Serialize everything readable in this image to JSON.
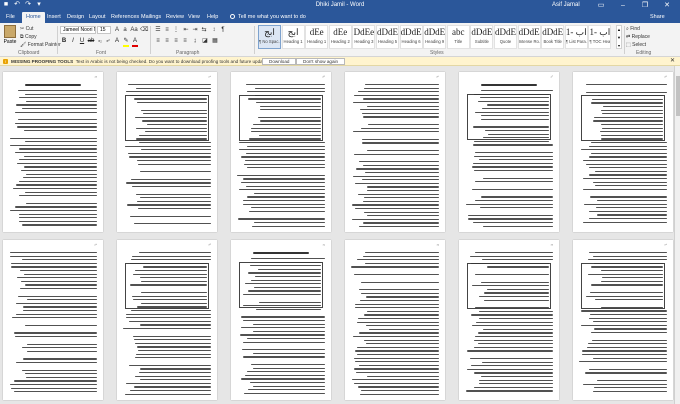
{
  "app": {
    "title": "Dhiki Jamil - Word",
    "user": "Asif Jamal",
    "quick_access": [
      "save-icon",
      "undo-icon",
      "redo-icon",
      "customize-icon"
    ],
    "window_controls": [
      "ribbon-display-icon",
      "minimize-icon",
      "restore-icon",
      "close-icon"
    ]
  },
  "tabs": [
    "File",
    "Home",
    "Insert",
    "Design",
    "Layout",
    "References",
    "Mailings",
    "Review",
    "View",
    "Help"
  ],
  "active_tab": "Home",
  "tell_me": "Tell me what you want to do",
  "share": "Share",
  "clipboard": {
    "paste": "Paste",
    "cut": "Cut",
    "copy": "Copy",
    "format_painter": "Format Painter",
    "label": "Clipboard"
  },
  "font": {
    "name": "Jameel Noori N",
    "size": "15",
    "label": "Font"
  },
  "paragraph": {
    "label": "Paragraph"
  },
  "styles": {
    "label": "Styles",
    "items": [
      {
        "preview": "ابج",
        "name": "¶ No Spac..."
      },
      {
        "preview": "ابج",
        "name": "Heading 1"
      },
      {
        "preview": "dEe",
        "name": "Heading 1"
      },
      {
        "preview": "dEe",
        "name": "Heading 2"
      },
      {
        "preview": "DdEe",
        "name": "Heading 3"
      },
      {
        "preview": "dDdEe",
        "name": "Heading 5"
      },
      {
        "preview": "dDdEe",
        "name": "Heading 6"
      },
      {
        "preview": "dDdEe",
        "name": "Heading 9"
      },
      {
        "preview": "abc",
        "name": "Title"
      },
      {
        "preview": "dDdEe",
        "name": "Subtitle"
      },
      {
        "preview": "dDdEe",
        "name": "Quote"
      },
      {
        "preview": "dDdEe",
        "name": "Intense Ro..."
      },
      {
        "preview": "dDdEe",
        "name": "Book Title"
      },
      {
        "preview": "اب -1",
        "name": "¶ List Para..."
      },
      {
        "preview": "اب -1",
        "name": "¶ TOC Hea..."
      }
    ]
  },
  "editing": {
    "find": "Find",
    "replace": "Replace",
    "select": "Select",
    "label": "Editing"
  },
  "message_bar": {
    "title": "MISSING PROOFING TOOLS",
    "text": "Text in Arabic is not being checked. Do you want to download proofing tools and future updates?",
    "download": "Download",
    "dismiss": "Don't show again"
  },
  "page_numbers": [
    "²³",
    "²⁴",
    "²⁵",
    "²⁶",
    "²⁷",
    "²⁸",
    "²⁹",
    "³⁰",
    "³¹",
    "³²",
    "³³",
    "³⁴"
  ]
}
